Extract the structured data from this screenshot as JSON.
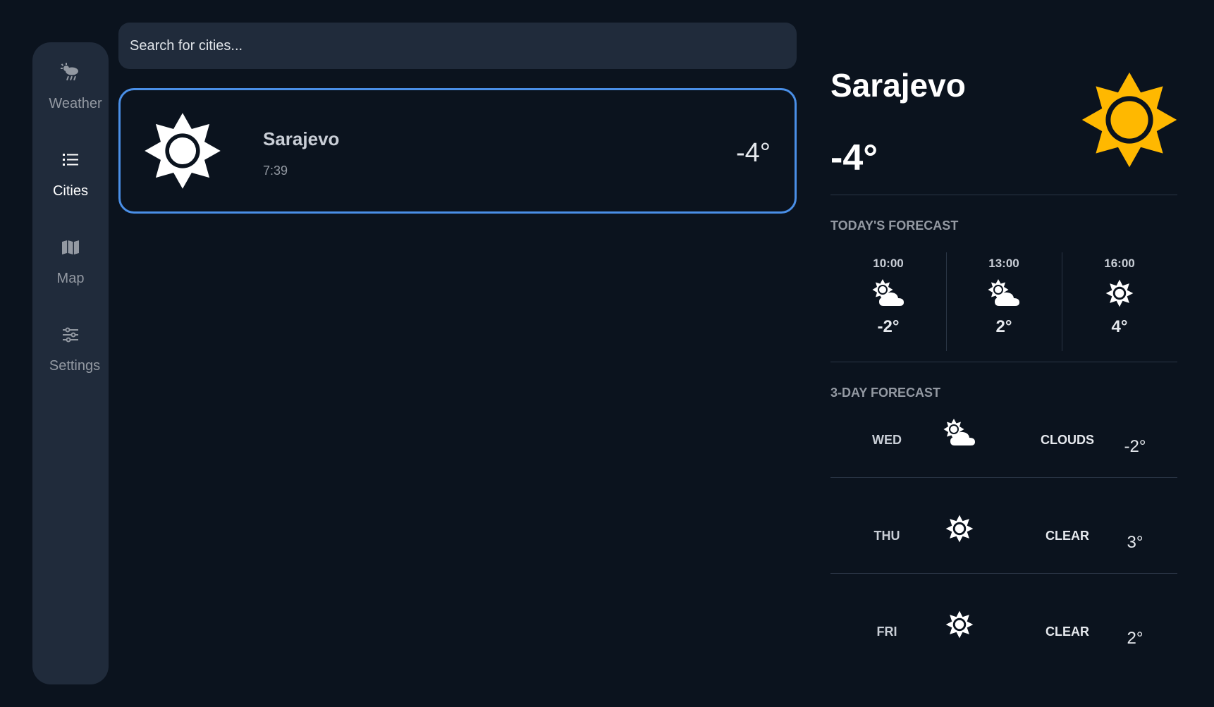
{
  "nav": {
    "items": [
      {
        "label": "Weather",
        "icon": "weather-icon",
        "active": false
      },
      {
        "label": "Cities",
        "icon": "list-icon",
        "active": true
      },
      {
        "label": "Map",
        "icon": "map-icon",
        "active": false
      },
      {
        "label": "Settings",
        "icon": "sliders-icon",
        "active": false
      }
    ]
  },
  "search": {
    "placeholder": "Search for cities..."
  },
  "city_card": {
    "name": "Sarajevo",
    "time": "7:39",
    "temp": "-4°",
    "icon": "sun-icon"
  },
  "detail": {
    "city": "Sarajevo",
    "temp": "-4°",
    "icon": "sun-icon",
    "today_title": "TODAY'S FORECAST",
    "hourly": [
      {
        "time": "10:00",
        "icon": "partly-cloudy-icon",
        "temp": "-2°"
      },
      {
        "time": "13:00",
        "icon": "partly-cloudy-icon",
        "temp": "2°"
      },
      {
        "time": "16:00",
        "icon": "sun-icon",
        "temp": "4°"
      }
    ],
    "days_title": "3-DAY FORECAST",
    "days": [
      {
        "day": "WED",
        "icon": "partly-cloudy-icon",
        "condition": "CLOUDS",
        "temp": "-2°"
      },
      {
        "day": "THU",
        "icon": "sun-icon",
        "condition": "CLEAR",
        "temp": "3°"
      },
      {
        "day": "FRI",
        "icon": "sun-icon",
        "condition": "CLEAR",
        "temp": "2°"
      }
    ]
  },
  "colors": {
    "background": "#0b131e",
    "panel": "#202b3b",
    "accent_border": "#4a8fe7",
    "sun_yellow": "#ffb800",
    "muted_text": "#9399a2"
  }
}
